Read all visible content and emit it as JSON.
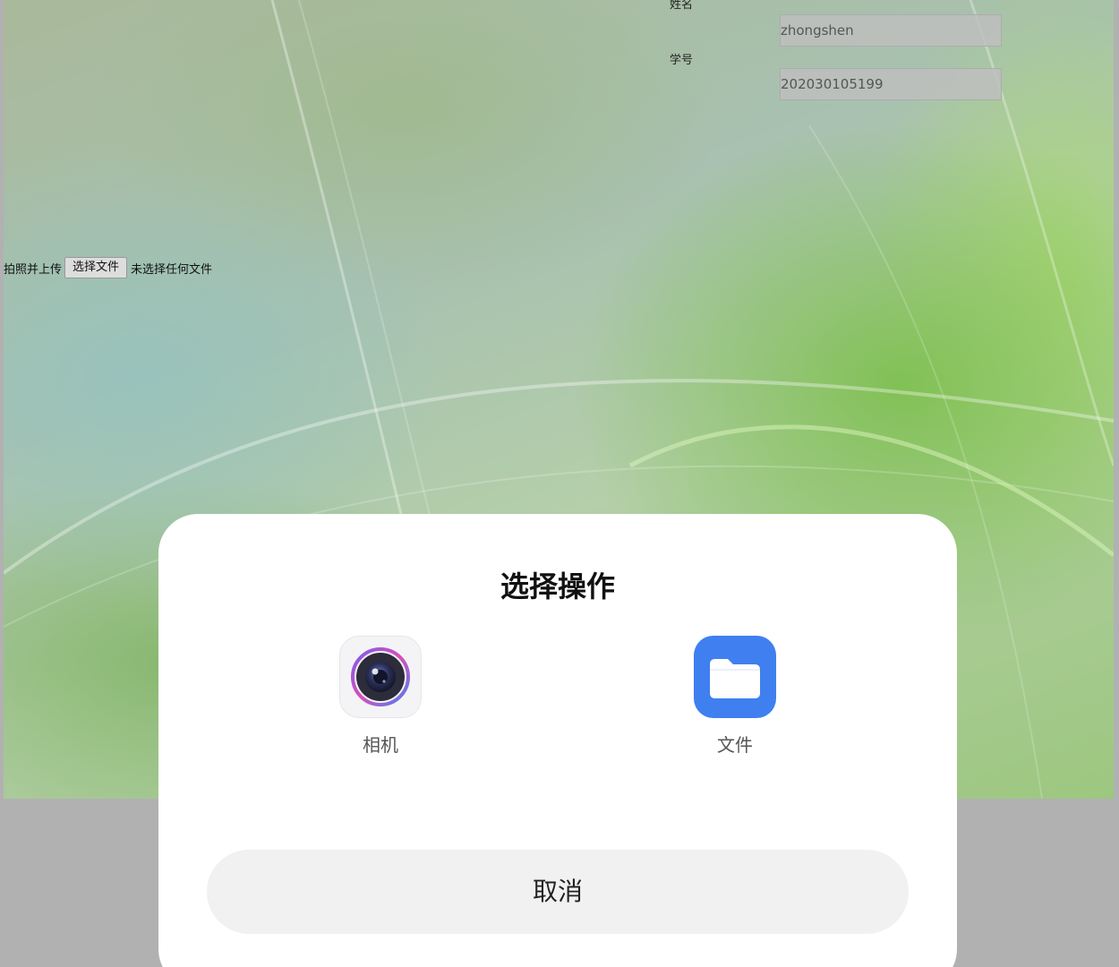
{
  "form": {
    "name_label": "姓名",
    "name_value": "zhongshen",
    "student_id_label": "学号",
    "student_id_value": "202030105199",
    "upload_label": "拍照并上传",
    "choose_file_label": "选择文件",
    "no_file_text": "未选择任何文件"
  },
  "sheet": {
    "title": "选择操作",
    "options": [
      {
        "label": "相机",
        "icon": "camera-icon"
      },
      {
        "label": "文件",
        "icon": "folder-icon"
      }
    ],
    "cancel_label": "取消"
  },
  "colors": {
    "sheet_bg": "#ffffff",
    "cancel_bg": "#f1f1f1",
    "files_icon": "#3f7ff0",
    "overlay": "#b1b1b1"
  }
}
